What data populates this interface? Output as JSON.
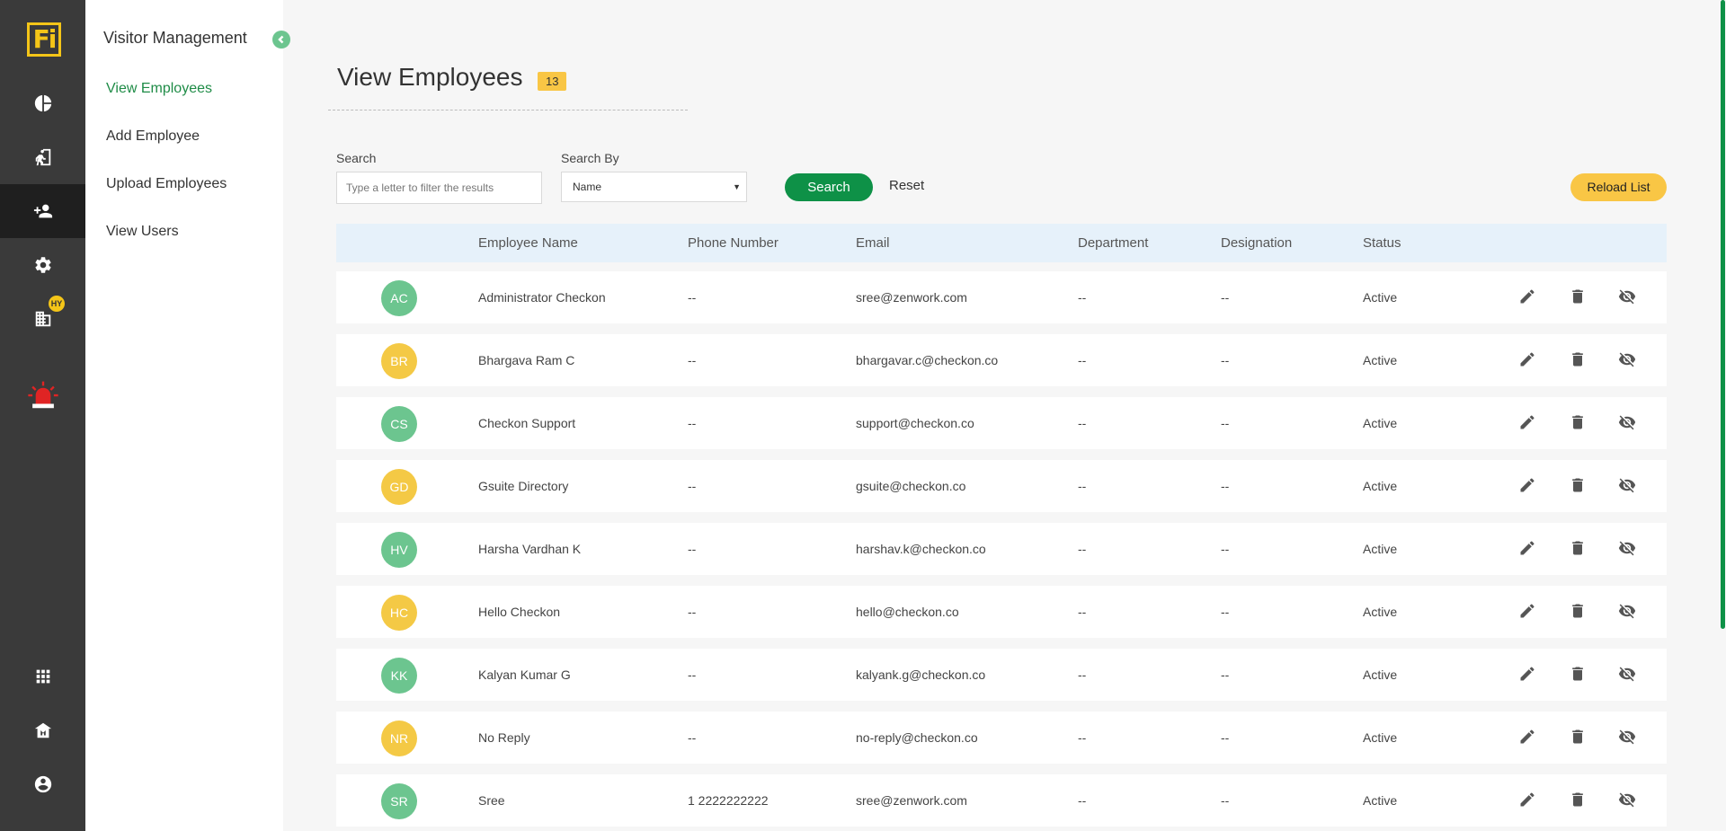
{
  "rail": {
    "logo_text": "Fi",
    "badge": "HY",
    "icons": [
      "dashboard-icon",
      "visitor-door-icon",
      "add-user-icon",
      "settings-icon",
      "building-icon",
      "emergency-alarm-icon",
      "apps-grid-icon",
      "home-icon",
      "profile-icon"
    ]
  },
  "subnav": {
    "title": "Visitor Management",
    "items": [
      {
        "label": "View Employees"
      },
      {
        "label": "Add Employee"
      },
      {
        "label": "Upload Employees"
      },
      {
        "label": "View Users"
      }
    ]
  },
  "page": {
    "title": "View Employees",
    "count": "13"
  },
  "filters": {
    "search_label": "Search",
    "search_placeholder": "Type a letter to filter the results",
    "search_by_label": "Search By",
    "search_by_value": "Name",
    "search_button": "Search",
    "reset_button": "Reset",
    "reload_button": "Reload List"
  },
  "table": {
    "columns": [
      "Employee Name",
      "Phone Number",
      "Email",
      "Department",
      "Designation",
      "Status"
    ],
    "rows": [
      {
        "initials": "AC",
        "name": "Administrator Checkon",
        "phone": "--",
        "email": "sree@zenwork.com",
        "department": "--",
        "designation": "--",
        "status": "Active"
      },
      {
        "initials": "BR",
        "name": "Bhargava Ram C",
        "phone": "--",
        "email": "bhargavar.c@checkon.co",
        "department": "--",
        "designation": "--",
        "status": "Active"
      },
      {
        "initials": "CS",
        "name": "Checkon Support",
        "phone": "--",
        "email": "support@checkon.co",
        "department": "--",
        "designation": "--",
        "status": "Active"
      },
      {
        "initials": "GD",
        "name": "Gsuite Directory",
        "phone": "--",
        "email": "gsuite@checkon.co",
        "department": "--",
        "designation": "--",
        "status": "Active"
      },
      {
        "initials": "HV",
        "name": "Harsha Vardhan K",
        "phone": "--",
        "email": "harshav.k@checkon.co",
        "department": "--",
        "designation": "--",
        "status": "Active"
      },
      {
        "initials": "HC",
        "name": "Hello Checkon",
        "phone": "--",
        "email": "hello@checkon.co",
        "department": "--",
        "designation": "--",
        "status": "Active"
      },
      {
        "initials": "KK",
        "name": "Kalyan Kumar G",
        "phone": "--",
        "email": "kalyank.g@checkon.co",
        "department": "--",
        "designation": "--",
        "status": "Active"
      },
      {
        "initials": "NR",
        "name": "No Reply",
        "phone": "--",
        "email": "no-reply@checkon.co",
        "department": "--",
        "designation": "--",
        "status": "Active"
      },
      {
        "initials": "SR",
        "name": "Sree",
        "phone": "1 2222222222",
        "email": "sree@zenwork.com",
        "department": "--",
        "designation": "--",
        "status": "Active"
      }
    ]
  },
  "colors": {
    "accent_green": "#0e9147",
    "avatar_green": "#6cc58f",
    "avatar_yellow": "#f4c945",
    "badge_yellow": "#f9c645"
  }
}
